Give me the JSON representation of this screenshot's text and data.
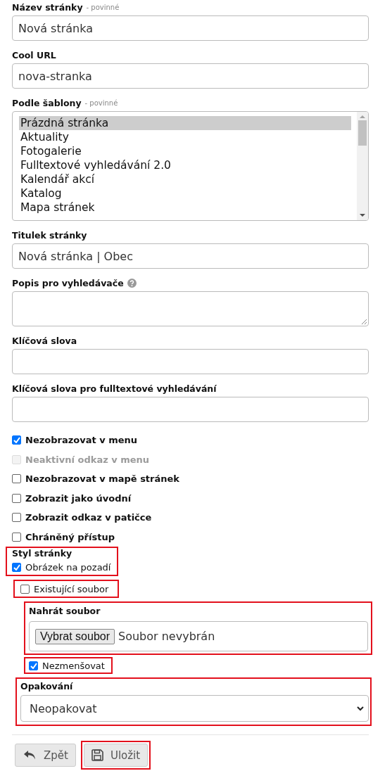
{
  "fields": [
    {
      "kind": "text",
      "label": "Název stránky",
      "note": "- povinné",
      "value": "Nová stránka"
    },
    {
      "kind": "text",
      "label": "Cool URL",
      "value": "nova-stranka"
    },
    {
      "kind": "listbox",
      "label": "Podle šablony",
      "note": "- povinné",
      "options": [
        {
          "label": "Prázdná stránka",
          "selected": true
        },
        {
          "label": "Aktuality",
          "selected": false
        },
        {
          "label": "Fotogalerie",
          "selected": false
        },
        {
          "label": "Fulltextové vyhledávání 2.0",
          "selected": false
        },
        {
          "label": "Kalendář akcí",
          "selected": false
        },
        {
          "label": "Katalog",
          "selected": false
        },
        {
          "label": "Mapa stránek",
          "selected": false
        }
      ]
    },
    {
      "kind": "text",
      "label": "Titulek stránky",
      "value": "Nová stránka | Obec"
    },
    {
      "kind": "textarea",
      "label": "Popis pro vyhledávače",
      "help": true
    },
    {
      "kind": "text",
      "label": "Klíčová slova"
    },
    {
      "kind": "text",
      "label": "Klíčová slova pro fulltextové vyhledávání"
    }
  ],
  "options": [
    {
      "label": "Nezobrazovat v menu",
      "checked": true,
      "disabled": false
    },
    {
      "label": "Neaktivní odkaz v menu",
      "checked": false,
      "disabled": true
    },
    {
      "label": "Nezobrazovat v mapě stránek",
      "checked": false,
      "disabled": false
    },
    {
      "label": "Zobrazit jako úvodní",
      "checked": false,
      "disabled": false
    },
    {
      "label": "Zobrazit odkaz v patičce",
      "checked": false,
      "disabled": false
    },
    {
      "label": "Chráněný přístup",
      "checked": false,
      "disabled": false
    }
  ],
  "page_style": {
    "highlighted": true,
    "title": "Styl stránky",
    "background_image": {
      "label": "Obrázek na pozadí",
      "checked": true
    }
  },
  "existing_file": {
    "highlighted": true,
    "label": "Existující soubor",
    "checked": false
  },
  "upload": {
    "highlighted": true,
    "label": "Nahrát soubor",
    "button": "Vybrat soubor",
    "status": "Soubor nevybrán"
  },
  "no_shrink": {
    "highlighted": true,
    "label": "Nezmenšovat",
    "checked": true
  },
  "repeat": {
    "highlighted": true,
    "label": "Opakování",
    "value": "Neopakovat"
  },
  "buttons": [
    {
      "kind": "back",
      "label": "Zpět",
      "highlighted": false
    },
    {
      "kind": "save",
      "label": "Uložit",
      "highlighted": true
    }
  ]
}
